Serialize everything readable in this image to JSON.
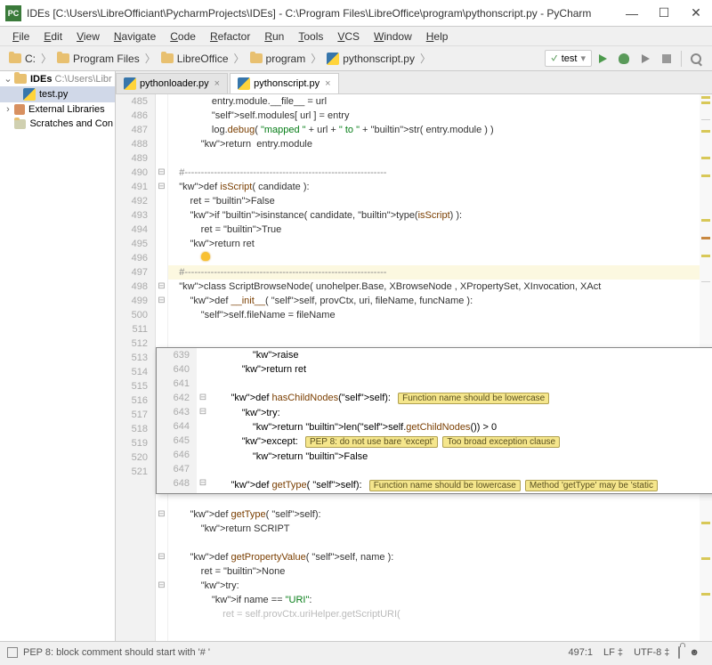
{
  "title": "IDEs [C:\\Users\\LibreOfficiant\\PycharmProjects\\IDEs] - C:\\Program Files\\LibreOffice\\program\\pythonscript.py - PyCharm",
  "menu": [
    "File",
    "Edit",
    "View",
    "Navigate",
    "Code",
    "Refactor",
    "Run",
    "Tools",
    "VCS",
    "Window",
    "Help"
  ],
  "crumbs": [
    "C:",
    "Program Files",
    "LibreOffice",
    "program",
    "pythonscript.py"
  ],
  "run_config": "test",
  "tree": {
    "root": "IDEs",
    "root_path": "C:\\Users\\Libr",
    "file": "test.py",
    "libs": "External Libraries",
    "scratch": "Scratches and Con"
  },
  "tabs": [
    {
      "name": "pythonloader.py",
      "active": false
    },
    {
      "name": "pythonscript.py",
      "active": true
    }
  ],
  "gut_main": [
    "485",
    "486",
    "487",
    "488",
    "489",
    "490",
    "491",
    "492",
    "493",
    "494",
    "495",
    "496",
    "497",
    "498",
    "499",
    "500",
    " ",
    " ",
    " ",
    " ",
    " ",
    " ",
    " ",
    " ",
    " ",
    " ",
    "511",
    "512",
    "513",
    "514",
    "515",
    "516",
    "517",
    "518",
    "519",
    "520",
    "521"
  ],
  "code_main": [
    "                entry.module.__file__ = url",
    "                self.modules[ url ] = entry",
    "                log.debug( \"mapped \" + url + \" to \" + str( entry.module ) )",
    "            return  entry.module",
    "",
    "    #--------------------------------------------------------------",
    "    def isScript( candidate ):",
    "        ret = False",
    "        if isinstance( candidate, type(isScript) ):",
    "            ret = True",
    "        return ret",
    "",
    "    #--------------------------------------------------------------",
    "    class ScriptBrowseNode( unohelper.Base, XBrowseNode , XPropertySet, XInvocation, XAct",
    "        def __init__( self, provCtx, uri, fileName, funcName ):",
    "            self.fileName = fileName"
  ],
  "code_tail": [
    "        def hasChildNodes(self):",
    "            return False",
    "",
    "        def getType( self):",
    "            return SCRIPT",
    "",
    "        def getPropertyValue( self, name ):",
    "            ret = None",
    "            try:",
    "                if name == \"URI\":"
  ],
  "popup_gut": [
    "639",
    "640",
    "641",
    "642",
    "643",
    "644",
    "645",
    "646",
    "647",
    "648"
  ],
  "popup_code": {
    "l0": "                raise",
    "l1": "            return ret",
    "l3": "        def hasChildNodes(self):",
    "l4": "            try:",
    "l5": "                return len(self.getChildNodes()) > 0",
    "l6": "            except:",
    "l8": "                return False",
    "l9": "        def getType( self):"
  },
  "insp": {
    "fn_lower": "Function name should be lowercase",
    "bare": "PEP 8: do not use bare 'except'",
    "broad": "Too broad exception clause",
    "static": "Method 'getType' may be 'static"
  },
  "status": {
    "msg": "PEP 8: block comment should start with '# '",
    "pos": "497:1",
    "le": "LF",
    "enc": "UTF-8"
  }
}
